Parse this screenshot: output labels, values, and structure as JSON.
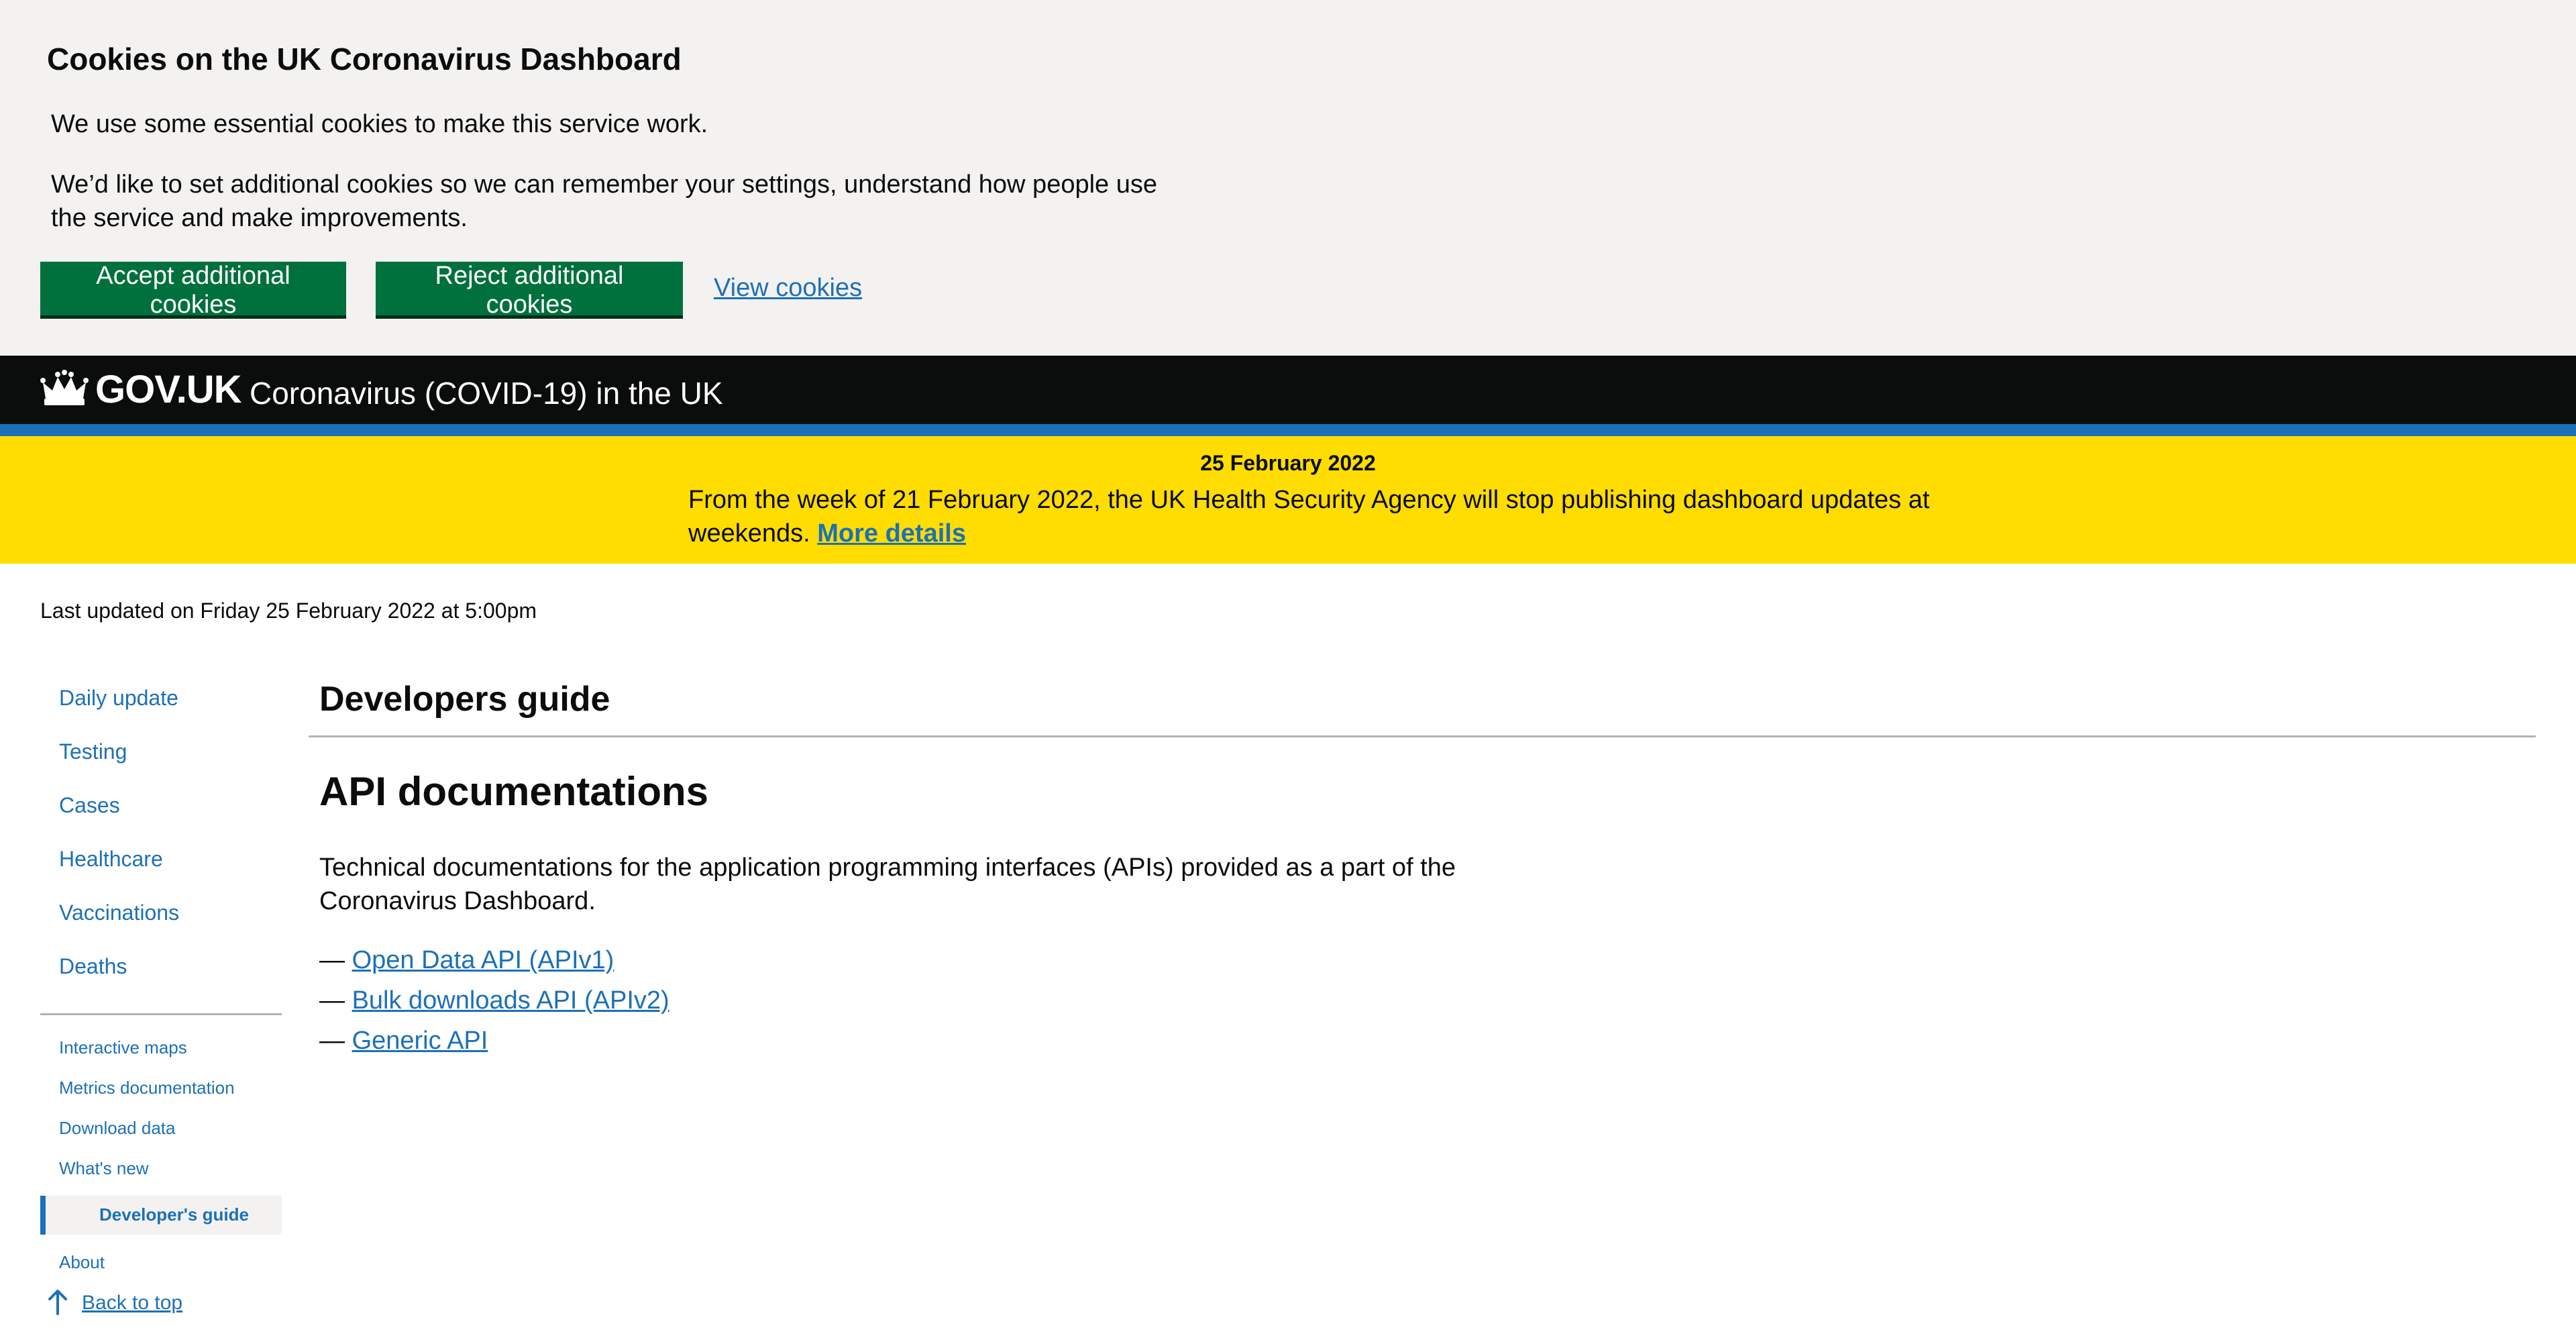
{
  "cookie_banner": {
    "title": "Cookies on the UK Coronavirus Dashboard",
    "paragraph1": "We use some essential cookies to make this service work.",
    "paragraph2": "We’d like to set additional cookies so we can remember your settings, understand how people use the service and make improvements.",
    "accept_label": "Accept additional cookies",
    "reject_label": "Reject additional cookies",
    "view_label": "View cookies"
  },
  "header": {
    "logo_text": "GOV.UK",
    "service_name": "Coronavirus (COVID-19) in the UK",
    "logo_icon": "crown-icon"
  },
  "announcement": {
    "date": "25 February 2022",
    "text": "From the week of 21 February 2022, the UK Health Security Agency will stop publishing dashboard updates at weekends.",
    "link_label": "More details"
  },
  "last_updated": "Last updated on Friday 25 February 2022 at 5:00pm",
  "sidebar": {
    "main_items": [
      {
        "label": "Daily update"
      },
      {
        "label": "Testing"
      },
      {
        "label": "Cases"
      },
      {
        "label": "Healthcare"
      },
      {
        "label": "Vaccinations"
      },
      {
        "label": "Deaths"
      }
    ],
    "secondary_items": [
      {
        "label": "Interactive maps"
      },
      {
        "label": "Metrics documentation"
      },
      {
        "label": "Download data"
      },
      {
        "label": "What's new"
      },
      {
        "label": "Developer's guide",
        "active": true
      },
      {
        "label": "About"
      }
    ],
    "back_to_top": "Back to top",
    "back_to_top_icon": "arrow-up-icon"
  },
  "main": {
    "page_title": "Developers guide",
    "section_title": "API documentations",
    "description": "Technical documentations for the application programming interfaces (APIs) provided as a part of the Coronavirus Dashboard.",
    "api_links": [
      {
        "prefix": "— ",
        "label": "Open Data API (APIv1)"
      },
      {
        "prefix": "— ",
        "label": "Bulk downloads API (APIv2)"
      },
      {
        "prefix": "— ",
        "label": "Generic API"
      }
    ]
  },
  "colors": {
    "accent_link": "#1d70b8",
    "button_green": "#00703c",
    "header_black": "#0b0c0c",
    "announcement_yellow": "#ffdd00",
    "banner_grey": "#f3f2f1"
  }
}
